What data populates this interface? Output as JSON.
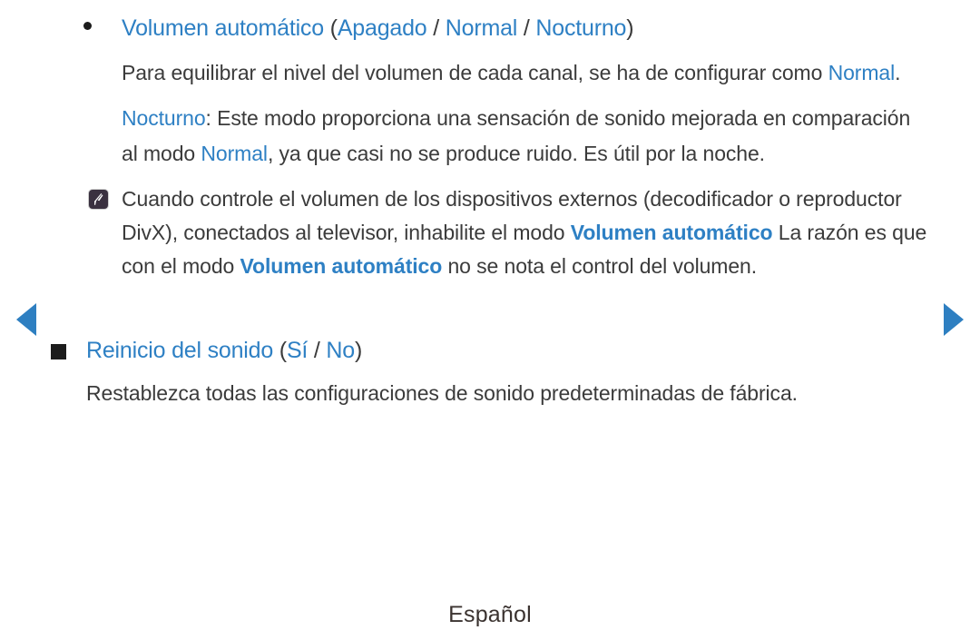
{
  "colors": {
    "accent_blue": "#2e80c4",
    "arrow_blue": "#2e7fc1",
    "body_text": "#3b3b3b",
    "bullet_black": "#1c1c1c",
    "note_badge": "#3a3140",
    "background": "#ffffff"
  },
  "nav": {
    "prev_label": "previous page",
    "next_label": "next page"
  },
  "sections": [
    {
      "bullet": "round",
      "heading": {
        "title": "Volumen automático",
        "paren_open": " (",
        "options": [
          "Apagado",
          "Normal",
          "Nocturno"
        ],
        "separator": " / ",
        "paren_close": ")"
      },
      "paragraphs": [
        {
          "runs": [
            {
              "text": "Para equilibrar el nivel del volumen de cada canal, se ha de configurar como ",
              "style": "plain"
            },
            {
              "text": "Normal",
              "style": "blue"
            },
            {
              "text": ".",
              "style": "plain"
            }
          ]
        },
        {
          "runs": [
            {
              "text": "Nocturno",
              "style": "blue"
            },
            {
              "text": ": Este modo proporciona una sensación de sonido mejorada en comparación al modo ",
              "style": "plain"
            },
            {
              "text": "Normal",
              "style": "blue"
            },
            {
              "text": ", ya que casi no se produce ruido. Es útil por la noche.",
              "style": "plain"
            }
          ]
        }
      ],
      "note": {
        "icon": "note-pencil-icon",
        "runs": [
          {
            "text": "Cuando controle el volumen de los dispositivos externos (decodificador o reproductor DivX), conectados al televisor, inhabilite el modo ",
            "style": "plain"
          },
          {
            "text": "Volumen automático",
            "style": "blue-bold"
          },
          {
            "text": " La razón es que con el modo ",
            "style": "plain"
          },
          {
            "text": "Volumen automático",
            "style": "blue-bold"
          },
          {
            "text": " no se nota el control del volumen.",
            "style": "plain"
          }
        ]
      }
    },
    {
      "bullet": "square",
      "heading": {
        "title": "Reinicio del sonido",
        "paren_open": " (",
        "options": [
          "Sí",
          "No"
        ],
        "separator": " / ",
        "paren_close": ")"
      },
      "paragraphs": [
        {
          "runs": [
            {
              "text": "Restablezca todas las configuraciones de sonido predeterminadas de fábrica.",
              "style": "plain"
            }
          ]
        }
      ]
    }
  ],
  "footer": {
    "language": "Español"
  }
}
